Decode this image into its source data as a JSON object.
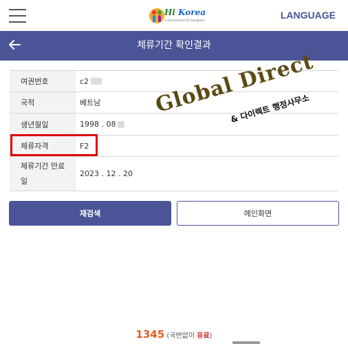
{
  "header": {
    "menu_icon": "hamburger-icon",
    "logo": {
      "brand_hi": "Hi",
      "brand_korea": " Korea",
      "tagline": "e-Government for Foreigners"
    },
    "language_label": "LANGUAGE"
  },
  "titlebar": {
    "back_icon": "arrow-left-icon",
    "title": "체류기간 확인결과"
  },
  "info_table": {
    "rows": [
      {
        "label": "여권번호",
        "value": "c2"
      },
      {
        "label": "국적",
        "value": "베트남"
      },
      {
        "label": "생년월일",
        "value": "1998 . 08"
      },
      {
        "label": "체류자격",
        "value": "F2"
      },
      {
        "label": "체류기간 만료일",
        "value": "2023 . 12 . 20"
      }
    ]
  },
  "watermark": {
    "line1": "Global Direct",
    "line2": "& 다이렉트 행정사무소"
  },
  "buttons": {
    "research": "재검색",
    "main": "메인화면"
  },
  "footer": {
    "number": "1345",
    "note_open": "(국번없이 ",
    "note_paid": "유료",
    "note_close": ")"
  },
  "colors": {
    "primary": "#4b5497",
    "highlight": "#e00000",
    "footer_number": "#e06020"
  }
}
